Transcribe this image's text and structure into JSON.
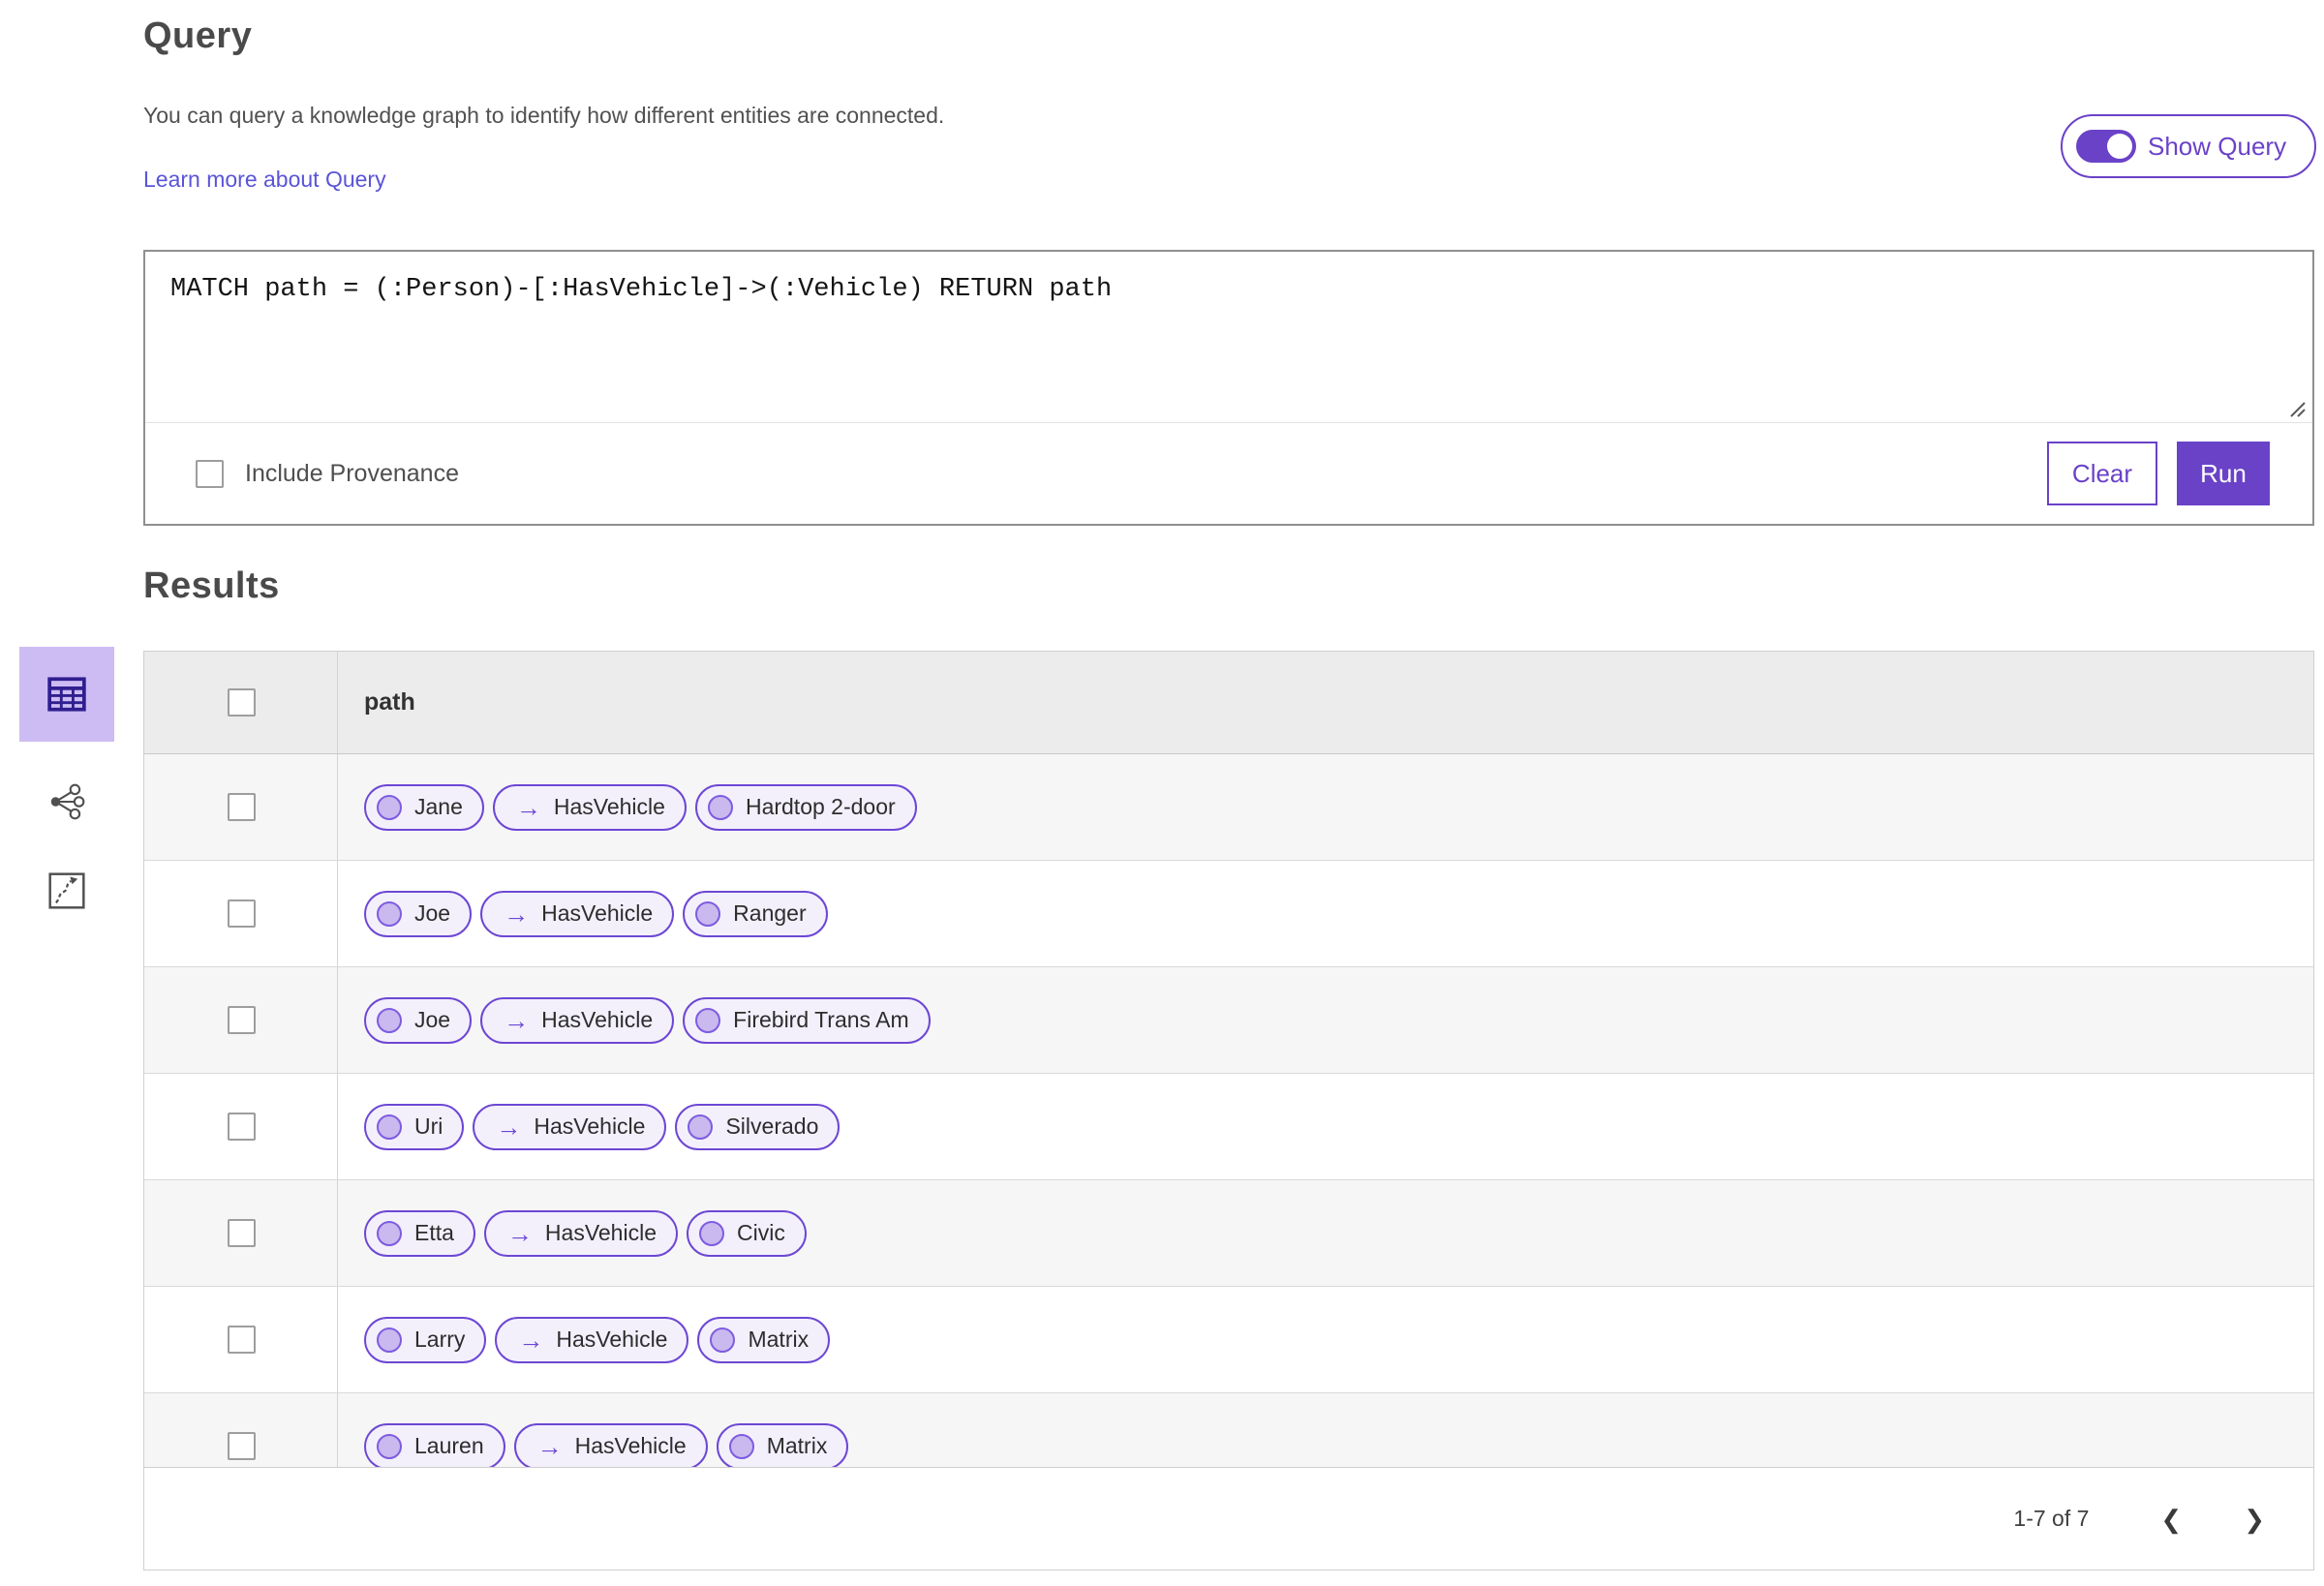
{
  "theme": {
    "accent": "#6a42c8",
    "accent-light": "#cdbcf3",
    "link": "#5a54d8",
    "pill-bg": "#f3f0fc",
    "pill-border": "#6d47d4",
    "pill-circle": "#c9b9ef",
    "pill-circle-border": "#7e5ce0",
    "header-bg": "#ececec",
    "row-alt": "#f6f6f6"
  },
  "icons": {
    "relationship_arrow": "→",
    "prev": "❮",
    "next": "❯",
    "view_icons": [
      "table-view-icon",
      "link-chart-view-icon",
      "map-view-icon"
    ]
  },
  "query": {
    "title": "Query",
    "description": "You can query a knowledge graph to identify how different entities are connected.",
    "learn_more_label": "Learn more about Query",
    "show_query_label": "Show Query",
    "show_query_on": true,
    "query_text": "MATCH path = (:Person)-[:HasVehicle]->(:Vehicle) RETURN path",
    "include_provenance_label": "Include Provenance",
    "include_provenance_checked": false,
    "clear_label": "Clear",
    "run_label": "Run"
  },
  "results": {
    "title": "Results",
    "table": {
      "column_header": "path",
      "rows": [
        {
          "source": "Jane",
          "relation": "HasVehicle",
          "target": "Hardtop 2-door"
        },
        {
          "source": "Joe",
          "relation": "HasVehicle",
          "target": "Ranger"
        },
        {
          "source": "Joe",
          "relation": "HasVehicle",
          "target": "Firebird Trans Am"
        },
        {
          "source": "Uri",
          "relation": "HasVehicle",
          "target": "Silverado"
        },
        {
          "source": "Etta",
          "relation": "HasVehicle",
          "target": "Civic"
        },
        {
          "source": "Larry",
          "relation": "HasVehicle",
          "target": "Matrix"
        },
        {
          "source": "Lauren",
          "relation": "HasVehicle",
          "target": "Matrix"
        }
      ]
    },
    "pagination": {
      "range_label": "1-7 of 7"
    }
  }
}
